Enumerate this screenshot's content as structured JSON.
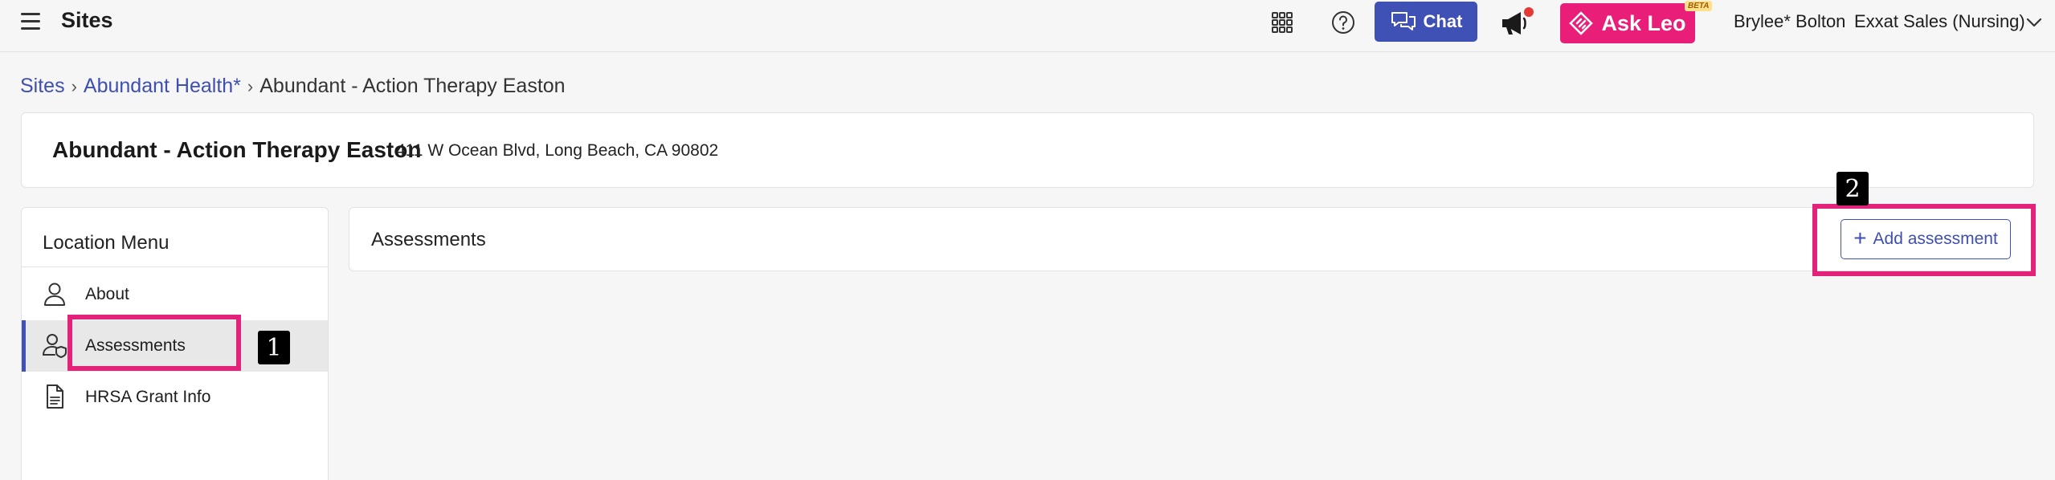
{
  "topbar": {
    "app_title": "Sites",
    "chat_label": "Chat",
    "askleo_label": "Ask Leo",
    "beta_label": "BETA",
    "user_name": "Brylee* Bolton",
    "org_name": "Exxat Sales (Nursing)",
    "icons": [
      "hamburger-menu-icon",
      "apps-grid-icon",
      "help-icon",
      "chat-bubbles-icon",
      "megaphone-icon",
      "leo-logo-icon",
      "chevron-down-icon"
    ],
    "colors": {
      "chat": "#3f51b5",
      "askleo": "#e91e78",
      "notification_dot": "#e53935"
    }
  },
  "breadcrumb": {
    "items": [
      "Sites",
      "Abundant Health*",
      "Abundant - Action Therapy Easton"
    ]
  },
  "site": {
    "name": "Abundant - Action Therapy Easton",
    "address": "411 W Ocean Blvd, Long Beach, CA 90802"
  },
  "location_menu": {
    "heading": "Location Menu",
    "items": [
      {
        "label": "About",
        "icon": "person-icon",
        "active": false
      },
      {
        "label": "Assessments",
        "icon": "person-shield-icon",
        "active": true
      },
      {
        "label": "HRSA Grant Info",
        "icon": "document-icon",
        "active": false
      }
    ]
  },
  "assessments": {
    "title": "Assessments",
    "add_label": "Add assessment"
  },
  "annotations": {
    "step1": "1",
    "step2": "2",
    "highlight_color": "#e3237a"
  }
}
